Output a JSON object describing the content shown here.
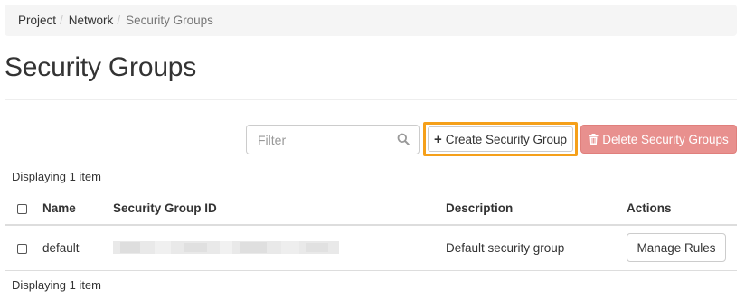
{
  "breadcrumb": {
    "items": [
      "Project",
      "Network",
      "Security Groups"
    ],
    "separator": "/"
  },
  "page": {
    "title": "Security Groups"
  },
  "toolbar": {
    "filter_placeholder": "Filter",
    "create_label": "Create Security Group",
    "delete_label": "Delete Security Groups",
    "highlight_color": "#f5a01a",
    "delete_color": "#e8908e"
  },
  "table": {
    "count_text": "Displaying 1 item",
    "columns": [
      "Name",
      "Security Group ID",
      "Description",
      "Actions"
    ],
    "rows": [
      {
        "name": "default",
        "description": "Default security group",
        "action_label": "Manage Rules"
      }
    ]
  }
}
